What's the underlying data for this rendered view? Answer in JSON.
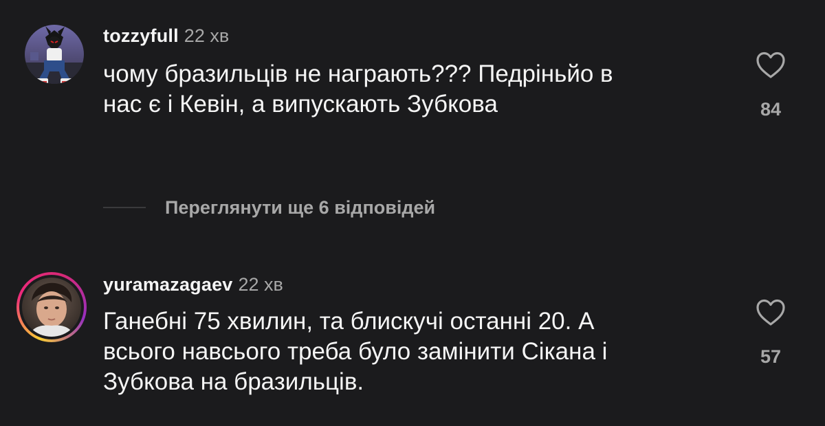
{
  "comments": [
    {
      "username": "tozzyfull",
      "time": "22 хв",
      "text_lines": [
        "чому бразильців не награють??? Педріньйо в",
        "нас є і Кевін, а випускають Зубкова"
      ],
      "likes": "84",
      "avatar_story_ring": false
    },
    {
      "username": "yuramazagaev",
      "time": "22 хв",
      "text_lines": [
        "Ганебні 75 хвилин, та блискучі останні 20. А",
        "всього навсього треба було замінити Сікана і",
        "Зубкова на бразильців."
      ],
      "likes": "57",
      "avatar_story_ring": true
    }
  ],
  "view_replies": {
    "label": "Переглянути ще 6 відповідей"
  },
  "colors": {
    "background": "#1b1b1d",
    "primary_text": "#f5f5f5",
    "secondary_text": "#a8a8a8",
    "heart_outline": "#a8a8a8"
  },
  "icons": {
    "like": "heart-outline-icon"
  }
}
